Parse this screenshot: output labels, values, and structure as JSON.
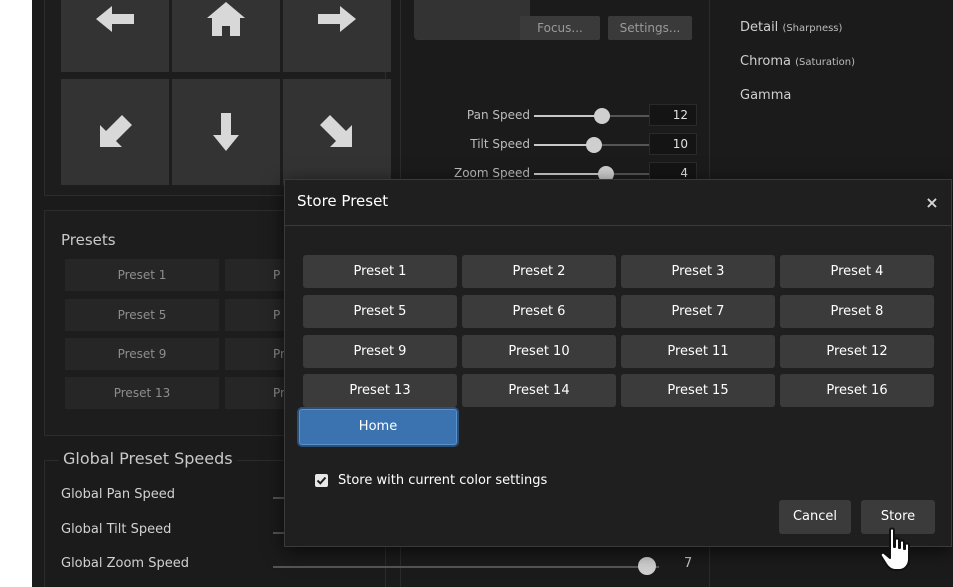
{
  "camera_buttons": {
    "focus_label": "Focus...",
    "settings_label": "Settings..."
  },
  "speeds": [
    {
      "label": "Pan Speed",
      "value": "12"
    },
    {
      "label": "Tilt Speed",
      "value": "10"
    },
    {
      "label": "Zoom Speed",
      "value": "4"
    }
  ],
  "color_settings": {
    "detail": "Detail",
    "detail_sub": "(Sharpness)",
    "chroma": "Chroma",
    "chroma_sub": "(Saturation)",
    "gamma": "Gamma"
  },
  "presets_panel": {
    "title": "Presets",
    "items": [
      "Preset 1",
      "Preset 5",
      "Preset 9",
      "Preset 13"
    ],
    "partial": [
      "P",
      "P",
      "Pr",
      "Pr"
    ]
  },
  "global_speeds": {
    "title": "Global Preset Speeds",
    "pan_label": "Global Pan Speed",
    "tilt_label": "Global Tilt Speed",
    "zoom_label": "Global Zoom Speed",
    "zoom_value": "7"
  },
  "modal": {
    "title": "Store Preset",
    "close_icon": "×",
    "presets": [
      "Preset 1",
      "Preset 2",
      "Preset 3",
      "Preset 4",
      "Preset 5",
      "Preset 6",
      "Preset 7",
      "Preset 8",
      "Preset 9",
      "Preset 10",
      "Preset 11",
      "Preset 12",
      "Preset 13",
      "Preset 14",
      "Preset 15",
      "Preset 16"
    ],
    "home_label": "Home",
    "checkbox_label": "Store with current color settings",
    "checkbox_checked": true,
    "cancel_label": "Cancel",
    "store_label": "Store"
  },
  "colors": {
    "accent": "#3a73b0",
    "background": "#1b1b1b",
    "button": "#3b3b3b"
  }
}
